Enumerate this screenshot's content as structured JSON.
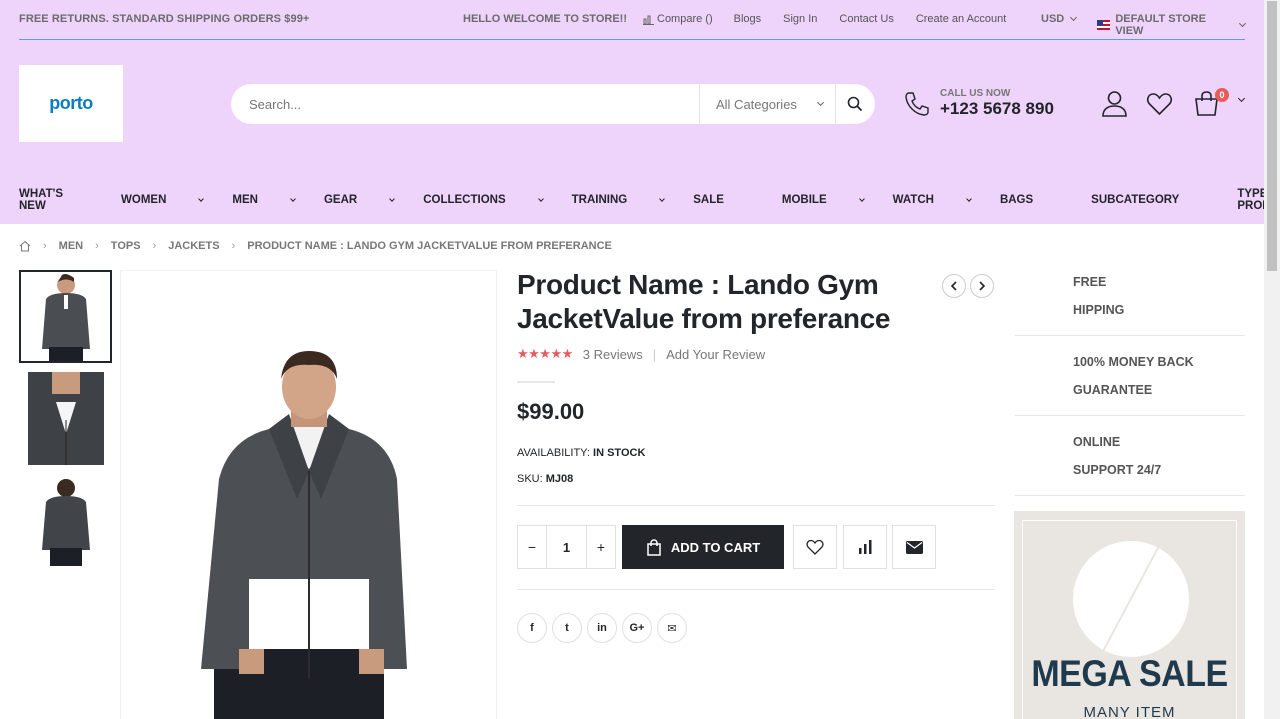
{
  "topbar": {
    "promo": "FREE RETURNS. STANDARD SHIPPING ORDERS $99+",
    "welcome": "HELLO WELCOME TO STORE!!",
    "links": [
      "Compare ()",
      "Blogs",
      "Sign In",
      "Contact Us",
      "Create an Account"
    ],
    "currency": "USD",
    "store_view": "DEFAULT STORE VIEW"
  },
  "header": {
    "logo_text": "porto",
    "search_placeholder": "Search...",
    "category": "All Categories",
    "call_label": "CALL US NOW",
    "call_number": "+123 5678 890",
    "cart_count": "0"
  },
  "nav": {
    "items": [
      {
        "label": "WHAT'S NEW",
        "dropdown": false
      },
      {
        "label": "WOMEN",
        "dropdown": true
      },
      {
        "label": "MEN",
        "dropdown": true
      },
      {
        "label": "GEAR",
        "dropdown": true
      },
      {
        "label": "COLLECTIONS",
        "dropdown": true
      },
      {
        "label": "TRAINING",
        "dropdown": true
      },
      {
        "label": "SALE",
        "dropdown": false
      },
      {
        "label": "MOBILE",
        "dropdown": true
      },
      {
        "label": "WATCH",
        "dropdown": true
      },
      {
        "label": "BAGS",
        "dropdown": false
      },
      {
        "label": "SUBCATEGORY",
        "dropdown": false
      },
      {
        "label": "TYPES OF PRODUCTS",
        "dropdown": false
      }
    ]
  },
  "breadcrumb": [
    "MEN",
    "TOPS",
    "JACKETS",
    "PRODUCT NAME : LANDO GYM JACKETVALUE FROM PREFERANCE"
  ],
  "product": {
    "title": "Product Name : Lando Gym JacketValue from preferance",
    "stars": "★★★★★",
    "reviews": "3  Reviews",
    "add_review": "Add Your Review",
    "price": "$99.00",
    "availability_label": "AVAILABILITY:",
    "availability_value": "IN STOCK",
    "sku_label": "SKU:",
    "sku_value": "MJ08",
    "qty": "1",
    "qty_minus": "−",
    "qty_plus": "+",
    "add_to_cart": "ADD TO CART"
  },
  "share": [
    "f",
    "t",
    "in",
    "G+",
    "✉"
  ],
  "features": [
    {
      "line1": "FREE",
      "line2": "HIPPING"
    },
    {
      "line1": "100% MONEY BACK",
      "line2": "GUARANTEE"
    },
    {
      "line1": "ONLINE",
      "line2": "SUPPORT 24/7"
    }
  ],
  "banner": {
    "headline": "MEGA SALE",
    "subline": "MANY ITEM"
  }
}
